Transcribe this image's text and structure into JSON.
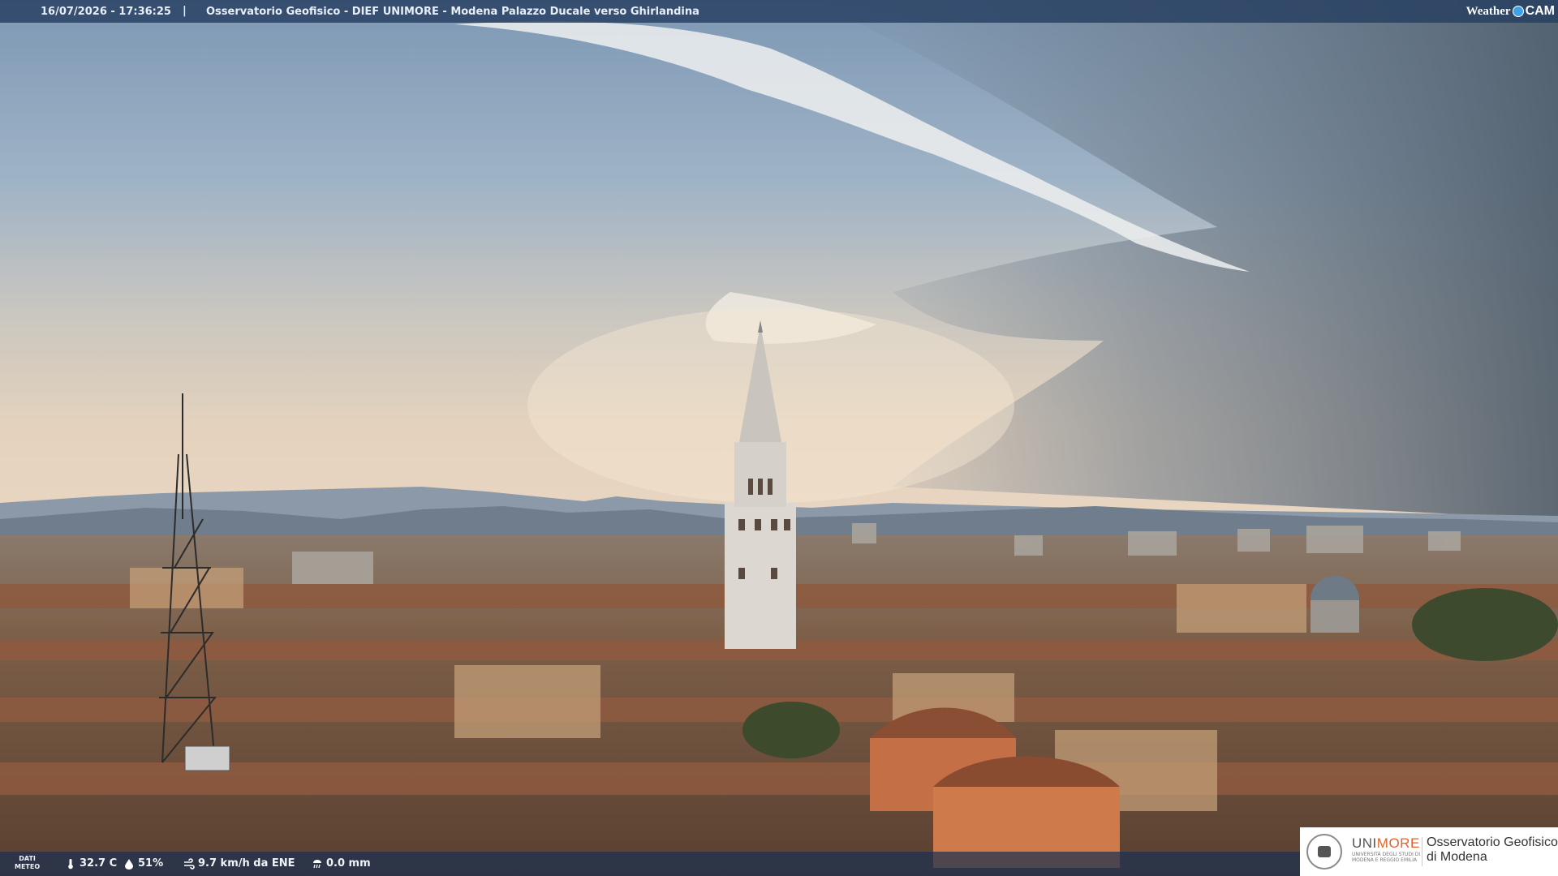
{
  "overlay": {
    "timestamp": "16/07/2026 - 17:36:25",
    "separator": "|",
    "title": "Osservatorio Geofisico - DIEF UNIMORE - Modena Palazzo Ducale verso Ghirlandina",
    "brand": {
      "weather": "Weather",
      "cam": "CAM"
    }
  },
  "meteo": {
    "label_top": "DATI",
    "label_bottom": "METEO",
    "temperature": "32.7 C",
    "humidity": "51%",
    "wind": "9.7 km/h da ENE",
    "rain": "0.0 mm",
    "icons": [
      "thermometer-icon",
      "humidity-drop-icon",
      "wind-icon",
      "rain-gauge-icon"
    ]
  },
  "logo": {
    "uni_prefix": "UNI",
    "uni_suffix": "MORE",
    "uni_sub_1": "UNIVERSITÀ DEGLI STUDI DI",
    "uni_sub_2": "MODENA E REGGIO EMILIA",
    "org_line_1": "Osservatorio Geofisico",
    "org_line_2": "di Modena"
  },
  "colors": {
    "accent_orange": "#e4632b",
    "bar_blue": "#263e60",
    "brand_dot": "#3fa2e6"
  }
}
